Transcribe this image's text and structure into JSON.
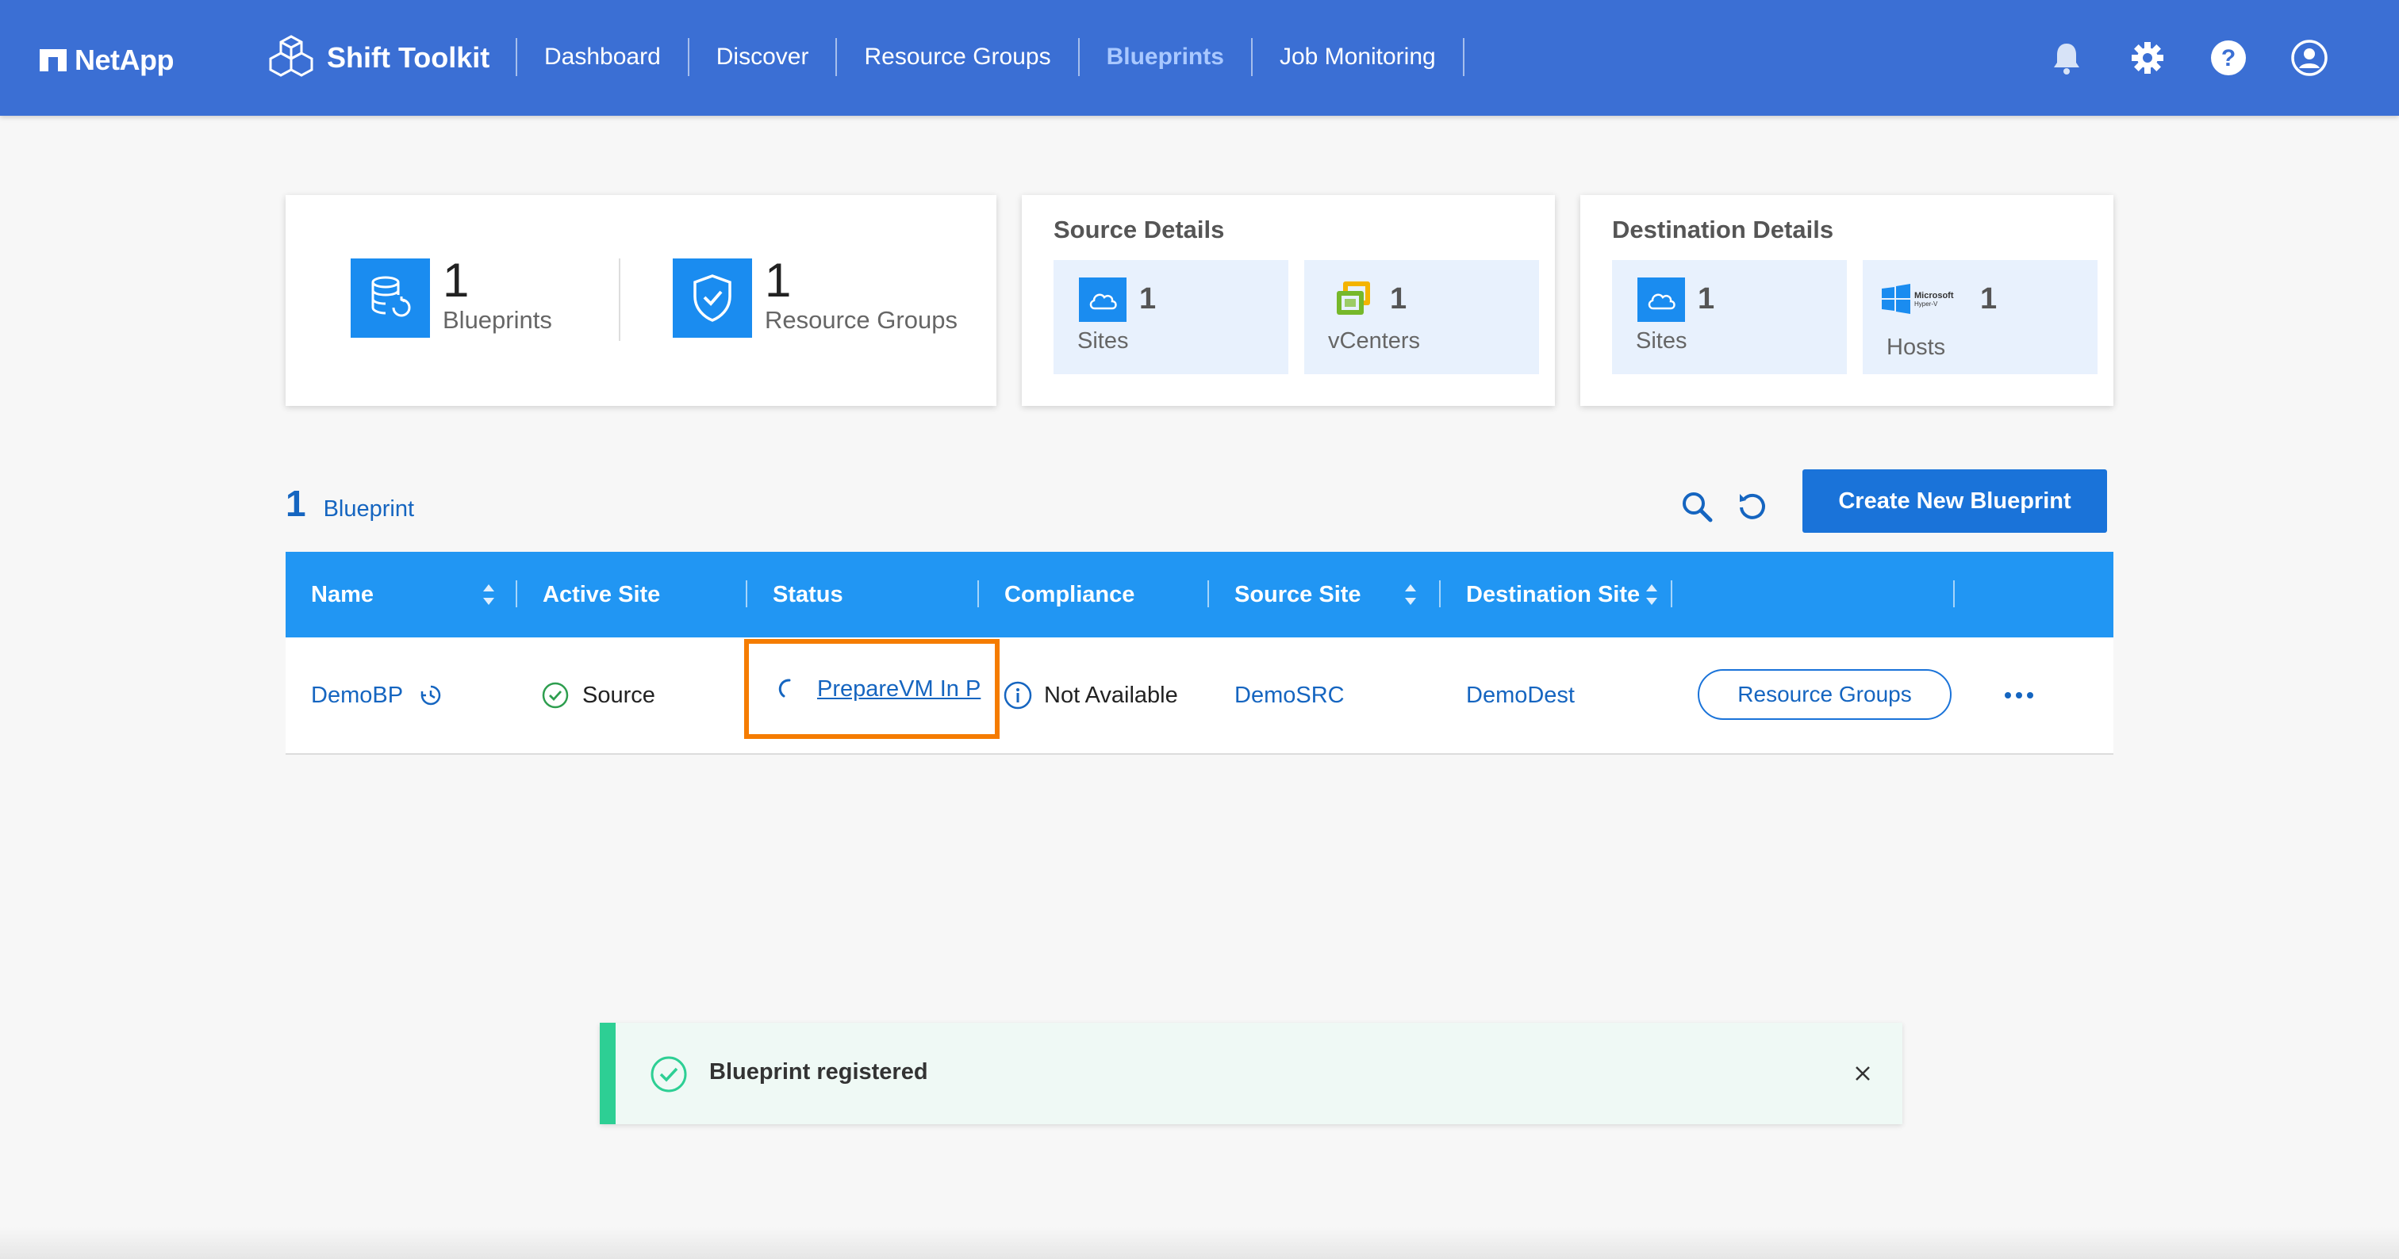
{
  "brand": {
    "name": "NetApp"
  },
  "app": {
    "title": "Shift Toolkit"
  },
  "nav": [
    {
      "label": "Dashboard",
      "active": false
    },
    {
      "label": "Discover",
      "active": false
    },
    {
      "label": "Resource Groups",
      "active": false
    },
    {
      "label": "Blueprints",
      "active": true
    },
    {
      "label": "Job Monitoring",
      "active": false
    }
  ],
  "header_icons": [
    "bell-icon",
    "gear-icon",
    "help-icon",
    "user-icon"
  ],
  "summary": {
    "blueprints": {
      "count": "1",
      "label": "Blueprints"
    },
    "resource_groups": {
      "count": "1",
      "label": "Resource Groups"
    }
  },
  "source_details": {
    "title": "Source Details",
    "sites": {
      "count": "1",
      "label": "Sites"
    },
    "vcenters": {
      "count": "1",
      "label": "vCenters"
    }
  },
  "destination_details": {
    "title": "Destination Details",
    "sites": {
      "count": "1",
      "label": "Sites"
    },
    "hosts": {
      "count": "1",
      "label": "Hosts",
      "logo_text_1": "Microsoft",
      "logo_text_2": "Hyper-V"
    }
  },
  "list": {
    "count": "1",
    "label": "Blueprint",
    "create_button": "Create New Blueprint"
  },
  "table": {
    "columns": [
      "Name",
      "Active Site",
      "Status",
      "Compliance",
      "Source Site",
      "Destination Site"
    ],
    "rows": [
      {
        "name": "DemoBP",
        "active_site": "Source",
        "status": "PrepareVM In P",
        "compliance": "Not Available",
        "source_site": "DemoSRC",
        "destination_site": "DemoDest",
        "action_button": "Resource Groups"
      }
    ]
  },
  "toast": {
    "message": "Blueprint registered"
  },
  "colors": {
    "header_bg": "#3b6fd4",
    "table_header": "#2196f3",
    "primary_button": "#1a73d9",
    "highlight_box": "#f57c00",
    "toast_accent": "#2dcf94",
    "success": "#2e9e4f"
  }
}
